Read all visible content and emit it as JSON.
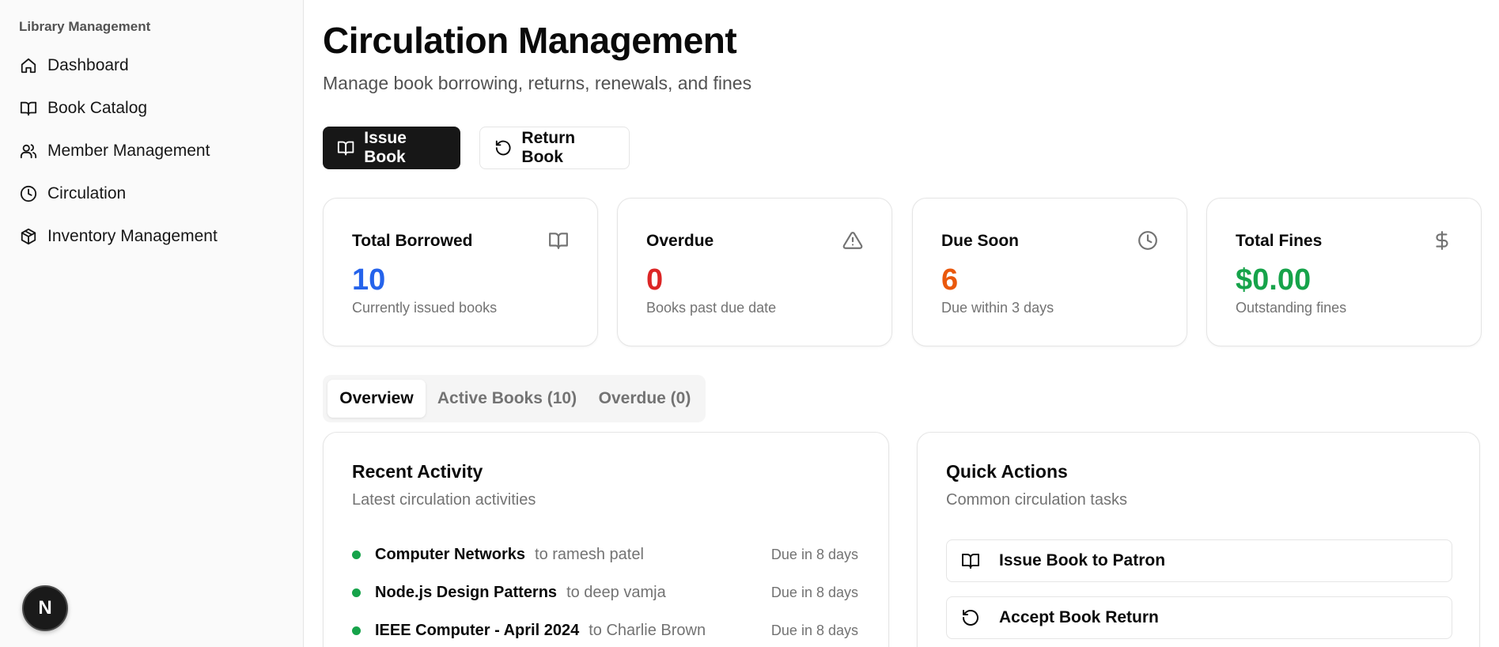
{
  "sidebar": {
    "group_label": "Library Management",
    "items": [
      {
        "label": "Dashboard",
        "icon": "home-icon"
      },
      {
        "label": "Book Catalog",
        "icon": "book-open-icon"
      },
      {
        "label": "Member Management",
        "icon": "users-icon"
      },
      {
        "label": "Circulation",
        "icon": "clock-icon"
      },
      {
        "label": "Inventory Management",
        "icon": "package-icon"
      }
    ],
    "badge_letter": "N"
  },
  "header": {
    "title": "Circulation Management",
    "subtitle": "Manage book borrowing, returns, renewals, and fines"
  },
  "actions": {
    "issue_label": "Issue Book",
    "return_label": "Return Book"
  },
  "stats": [
    {
      "title": "Total Borrowed",
      "value": "10",
      "desc": "Currently issued books",
      "color": "#2563eb",
      "icon": "book-open-icon"
    },
    {
      "title": "Overdue",
      "value": "0",
      "desc": "Books past due date",
      "color": "#dc2626",
      "icon": "alert-triangle-icon"
    },
    {
      "title": "Due Soon",
      "value": "6",
      "desc": "Due within 3 days",
      "color": "#ea580c",
      "icon": "clock-icon"
    },
    {
      "title": "Total Fines",
      "value": "$0.00",
      "desc": "Outstanding fines",
      "color": "#16a34a",
      "icon": "dollar-icon"
    }
  ],
  "tabs": [
    {
      "label": "Overview",
      "active": true
    },
    {
      "label": "Active Books (10)",
      "active": false
    },
    {
      "label": "Overdue (0)",
      "active": false
    }
  ],
  "recent_activity": {
    "title": "Recent Activity",
    "subtitle": "Latest circulation activities",
    "items": [
      {
        "book": "Computer Networks",
        "patron": "to ramesh patel",
        "due": "Due in 8 days"
      },
      {
        "book": "Node.js Design Patterns",
        "patron": "to deep vamja",
        "due": "Due in 8 days"
      },
      {
        "book": "IEEE Computer - April 2024",
        "patron": "to Charlie Brown",
        "due": "Due in 8 days"
      }
    ]
  },
  "quick_actions": {
    "title": "Quick Actions",
    "subtitle": "Common circulation tasks",
    "items": [
      {
        "label": "Issue Book to Patron",
        "icon": "book-open-icon"
      },
      {
        "label": "Accept Book Return",
        "icon": "rotate-ccw-icon"
      }
    ]
  }
}
